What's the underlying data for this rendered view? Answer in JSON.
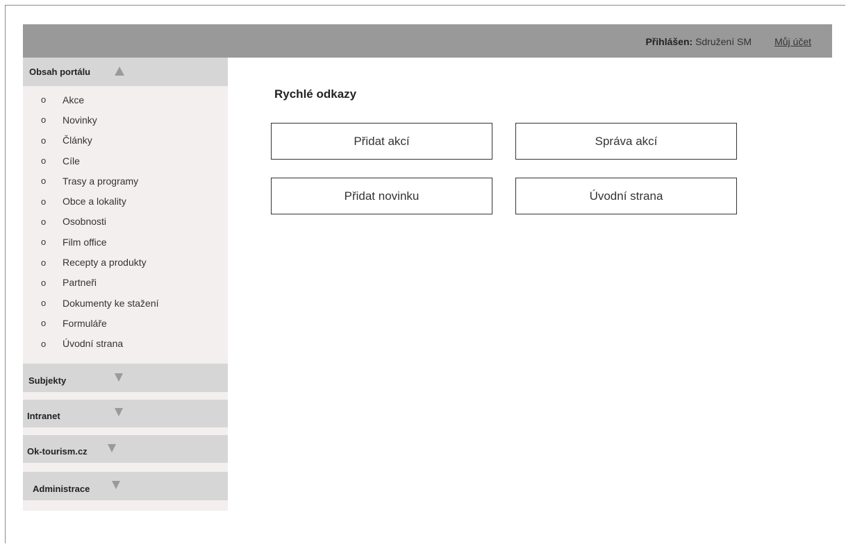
{
  "header": {
    "logged_label": "Přihlášen:",
    "user_name": "Sdružení SM",
    "account_link": "Můj účet"
  },
  "sidebar": {
    "sections": [
      {
        "label": "Obsah portálu",
        "state": "expanded"
      },
      {
        "label": "Subjekty",
        "state": "collapsed"
      },
      {
        "label": "Intranet",
        "state": "collapsed"
      },
      {
        "label": "Ok-tourism.cz",
        "state": "collapsed"
      },
      {
        "label": "Administrace",
        "state": "collapsed"
      }
    ],
    "bullet": "o",
    "items": [
      "Akce",
      "Novinky",
      "Články",
      "Cíle",
      "Trasy a programy",
      "Obce a lokality",
      "Osobnosti",
      "Film office",
      "Recepty a produkty",
      "Partneři",
      "Dokumenty ke stažení",
      "Formuláře",
      "Úvodní strana"
    ]
  },
  "main": {
    "title": "Rychlé odkazy",
    "quick_links": [
      "Přidat akcí",
      "Správa akcí",
      "Přidat novinku",
      "Úvodní strana"
    ]
  },
  "colors": {
    "topbar": "#999999",
    "sidebar_bg": "#f3efee",
    "section_header": "#d6d6d6"
  }
}
